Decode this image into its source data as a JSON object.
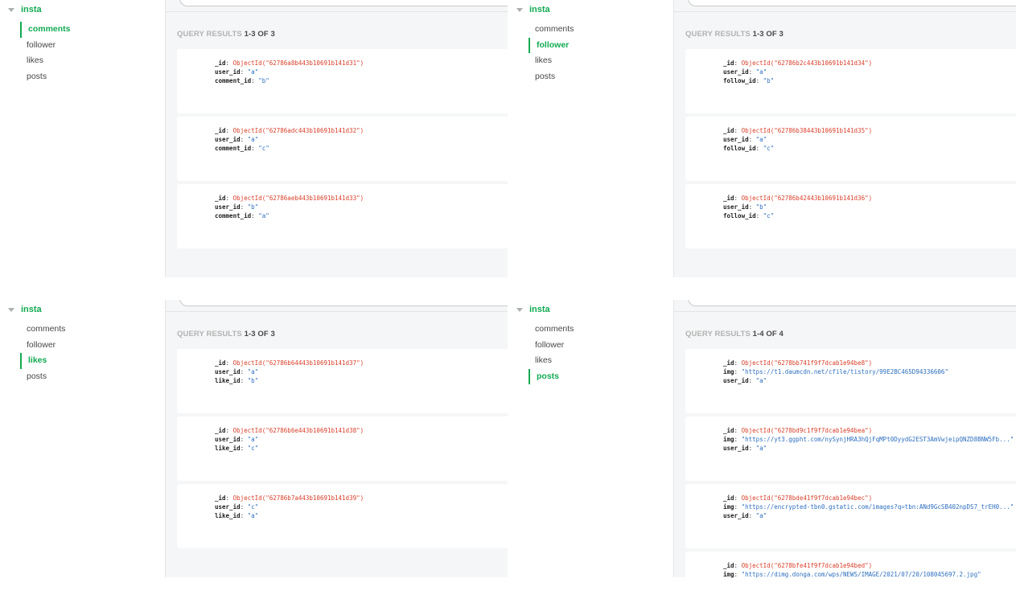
{
  "panels": [
    {
      "db_name": "insta",
      "collections": [
        "comments",
        "follower",
        "likes",
        "posts"
      ],
      "active": 0,
      "results_label": "QUERY RESULTS",
      "results_count": "1-3 OF 3",
      "documents": [
        {
          "fields": [
            {
              "key": "_id",
              "oid": "ObjectId(",
              "value": "\"62786a8b443b10691b141d31\"",
              "close": ")"
            },
            {
              "key": "user_id",
              "value": "\"a\""
            },
            {
              "key": "comment_id",
              "value": "\"b\""
            }
          ]
        },
        {
          "fields": [
            {
              "key": "_id",
              "oid": "ObjectId(",
              "value": "\"62786adc443b10691b141d32\"",
              "close": ")"
            },
            {
              "key": "user_id",
              "value": "\"a\""
            },
            {
              "key": "comment_id",
              "value": "\"c\""
            }
          ]
        },
        {
          "fields": [
            {
              "key": "_id",
              "oid": "ObjectId(",
              "value": "\"62786aeb443b10691b141d33\"",
              "close": ")"
            },
            {
              "key": "user_id",
              "value": "\"b\""
            },
            {
              "key": "comment_id",
              "value": "\"a\""
            }
          ]
        }
      ]
    },
    {
      "db_name": "insta",
      "collections": [
        "comments",
        "follower",
        "likes",
        "posts"
      ],
      "active": 1,
      "results_label": "QUERY RESULTS",
      "results_count": "1-3 OF 3",
      "documents": [
        {
          "fields": [
            {
              "key": "_id",
              "oid": "ObjectId(",
              "value": "\"62786b2c443b10691b141d34\"",
              "close": ")"
            },
            {
              "key": "user_id",
              "value": "\"a\""
            },
            {
              "key": "follow_id",
              "value": "\"b\""
            }
          ]
        },
        {
          "fields": [
            {
              "key": "_id",
              "oid": "ObjectId(",
              "value": "\"62786b38443b10691b141d35\"",
              "close": ")"
            },
            {
              "key": "user_id",
              "value": "\"a\""
            },
            {
              "key": "follow_id",
              "value": "\"c\""
            }
          ]
        },
        {
          "fields": [
            {
              "key": "_id",
              "oid": "ObjectId(",
              "value": "\"62786b42443b10691b141d36\"",
              "close": ")"
            },
            {
              "key": "user_id",
              "value": "\"b\""
            },
            {
              "key": "follow_id",
              "value": "\"c\""
            }
          ]
        }
      ]
    },
    {
      "db_name": "insta",
      "collections": [
        "comments",
        "follower",
        "likes",
        "posts"
      ],
      "active": 2,
      "results_label": "QUERY RESULTS",
      "results_count": "1-3 OF 3",
      "documents": [
        {
          "fields": [
            {
              "key": "_id",
              "oid": "ObjectId(",
              "value": "\"62786b64443b10691b141d37\"",
              "close": ")"
            },
            {
              "key": "user_id",
              "value": "\"a\""
            },
            {
              "key": "like_id",
              "value": "\"b\""
            }
          ]
        },
        {
          "fields": [
            {
              "key": "_id",
              "oid": "ObjectId(",
              "value": "\"62786b6e443b10691b141d38\"",
              "close": ")"
            },
            {
              "key": "user_id",
              "value": "\"a\""
            },
            {
              "key": "like_id",
              "value": "\"c\""
            }
          ]
        },
        {
          "fields": [
            {
              "key": "_id",
              "oid": "ObjectId(",
              "value": "\"62786b7a443b10691b141d39\"",
              "close": ")"
            },
            {
              "key": "user_id",
              "value": "\"c\""
            },
            {
              "key": "like_id",
              "value": "\"a\""
            }
          ]
        }
      ]
    },
    {
      "db_name": "insta",
      "collections": [
        "comments",
        "follower",
        "likes",
        "posts"
      ],
      "active": 3,
      "results_label": "QUERY RESULTS",
      "results_count": "1-4 OF 4",
      "documents": [
        {
          "fields": [
            {
              "key": "_id",
              "oid": "ObjectId(",
              "value": "\"6278bb741f9f7dcab1e94be8\"",
              "close": ")"
            },
            {
              "key": "img",
              "value": "\"https://t1.daumcdn.net/cfile/tistory/99E2BC465D94336606\""
            },
            {
              "key": "user_id",
              "value": "\"a\""
            }
          ]
        },
        {
          "fields": [
            {
              "key": "_id",
              "oid": "ObjectId(",
              "value": "\"6278bd9c1f9f7dcab1e94bea\"",
              "close": ")"
            },
            {
              "key": "img",
              "value": "\"https://yt3.ggpht.com/nySynjHRA3hQjFqMPt0DyydG2EST3AmVwjeipQNZD8BNW5Fb...\""
            },
            {
              "key": "user_id",
              "value": "\"a\""
            }
          ]
        },
        {
          "fields": [
            {
              "key": "_id",
              "oid": "ObjectId(",
              "value": "\"6278bde41f9f7dcab1e94bec\"",
              "close": ")"
            },
            {
              "key": "img",
              "value": "\"https://encrypted-tbn0.gstatic.com/images?q=tbn:ANd9GcSB402npDS7_trEH0...\""
            },
            {
              "key": "user_id",
              "value": "\"a\""
            }
          ]
        },
        {
          "fields": [
            {
              "key": "_id",
              "oid": "ObjectId(",
              "value": "\"6278bfe41f9f7dcab1e94bed\"",
              "close": ")"
            },
            {
              "key": "img",
              "value": "\"https://dimg.donga.com/wps/NEWS/IMAGE/2021/07/20/108045697.2.jpg\""
            }
          ]
        }
      ]
    }
  ]
}
